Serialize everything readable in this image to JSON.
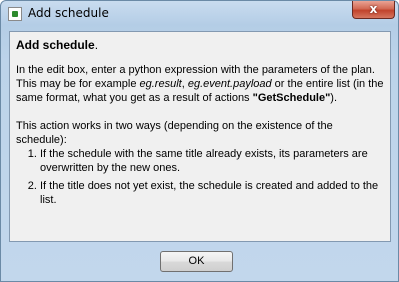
{
  "window": {
    "title": "Add schedule",
    "app_icon": "app-icon",
    "close_glyph": "x"
  },
  "content": {
    "heading": "Add schedule",
    "heading_suffix": ".",
    "para1": {
      "t1": "In the edit box, enter a python expression with the parameters of the plan. This may be for example ",
      "em1": "eg.result",
      "t2": ", ",
      "em2": "eg.event.payload",
      "t3": " or the entire list (in the same format, what you get as a result of actions ",
      "strong": "\"GetSchedule\"",
      "t4": ")."
    },
    "para2": "This action works in two ways (depending on the existence of the schedule):",
    "list": [
      "If the schedule with the same title already exists, its parameters are overwritten by the new ones.",
      "If the title does not yet exist, the schedule is created and added to the list."
    ]
  },
  "buttons": {
    "ok_label": "OK"
  }
}
